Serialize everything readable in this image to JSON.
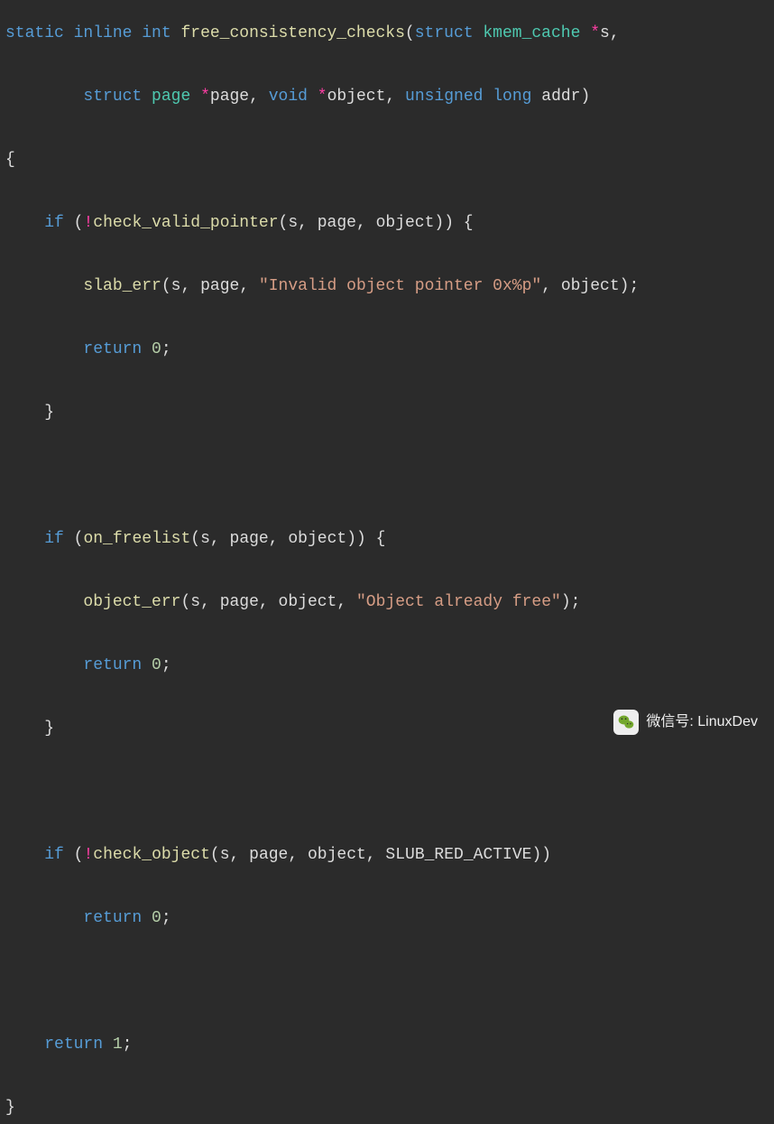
{
  "code": {
    "t": {
      "static": "static",
      "inline": "inline",
      "int": "int",
      "struct": "struct",
      "void": "void",
      "unsigned": "unsigned",
      "long": "long",
      "if": "if",
      "return": "return"
    },
    "fn": {
      "free_consistency_checks": "free_consistency_checks",
      "check_valid_pointer": "check_valid_pointer",
      "slab_err": "slab_err",
      "on_freelist": "on_freelist",
      "object_err": "object_err",
      "check_object": "check_object"
    },
    "id": {
      "kmem_cache": "kmem_cache",
      "s": "s",
      "page_t": "page",
      "page": "page",
      "object": "object",
      "addr": "addr",
      "SLUB_RED_ACTIVE": "SLUB_RED_ACTIVE"
    },
    "str": {
      "invalid": "\"Invalid object pointer 0x%p\"",
      "already_free": "\"Object already free\""
    },
    "num": {
      "zero": "0",
      "one": "1"
    }
  },
  "watermark": {
    "label": "微信号: LinuxDev"
  }
}
